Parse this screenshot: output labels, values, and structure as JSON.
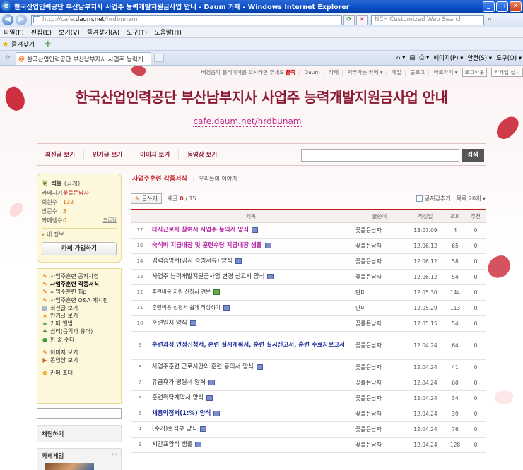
{
  "browser": {
    "window_title": "한국산업인력공단 부산남부지사 사업주 능력개발지원금사업 안내 - Daum 카페 - Windows Internet Explorer",
    "url_prefix": "http://cafe.",
    "url_domain": "daum.net",
    "url_path": "/hrdbunam",
    "search_placeholder": "NCH Customized Web Search",
    "menu": [
      "파일(F)",
      "편집(E)",
      "보기(V)",
      "즐겨찾기(A)",
      "도구(T)",
      "도움말(H)"
    ],
    "favorites_label": "즐겨찾기",
    "tab_title": "한국산업인력공단 부산남부지사 사업주 능력개...",
    "cmd": [
      "페이지(P) ▾",
      "안전(S) ▾",
      "도구(O) ▾"
    ]
  },
  "cafe": {
    "topmenu": {
      "bgm": "배경음악 플레이어를 끄시려면 주세요",
      "bgm_bold": "끌쭉",
      "links": [
        "Daum",
        "카페",
        "자주가는 카페 ▾",
        "메일",
        "블로그",
        "바로가기 ▾"
      ],
      "logout": "로그아웃",
      "install": "카페앱 설치"
    },
    "title": "한국산업인력공단 부산남부지사 사업주 능력개발지원금사업 안내",
    "url": "cafe.daum.net/hrdbunam",
    "nav": [
      "최신글 보기",
      "인기글 보기",
      "이미지 보기",
      "동영상 보기"
    ],
    "search_btn": "검색"
  },
  "sidebar": {
    "level": "석불",
    "visibility": "(공개)",
    "rows": [
      {
        "k": "카페지기",
        "v": "꽃를든남자"
      },
      {
        "k": "회원수",
        "v": "132"
      },
      {
        "k": "방문수",
        "v": "5"
      },
      {
        "k": "카페랭수",
        "v": "0",
        "extra": "프로필"
      }
    ],
    "myinfo": "내 정보",
    "join": "카페 가입하기",
    "menu1": [
      {
        "icon": "✎",
        "color": "#d26a00",
        "label": "사업주훈련 공지사항"
      },
      {
        "icon": "✎",
        "color": "#d26a00",
        "label": "사업주훈련 각종서식",
        "active": true
      },
      {
        "icon": "✎",
        "color": "#d26a00",
        "label": "사업주훈련 Tip"
      },
      {
        "icon": "✎",
        "color": "#d26a00",
        "label": "사업주훈련 Q&A 게시판"
      },
      {
        "icon": "▤",
        "color": "#5a7fc0",
        "label": "최신글 보기"
      },
      {
        "icon": "★",
        "color": "#e0a000",
        "label": "인기글 보기"
      },
      {
        "icon": "◈",
        "color": "#4a8a3a",
        "label": "카페 앨범"
      },
      {
        "icon": "♣",
        "color": "#4a8a3a",
        "label": "쉼터(음악과 유머)"
      },
      {
        "icon": "●",
        "color": "#3a9a3a",
        "label": "한 줄 수다"
      }
    ],
    "menu2": [
      {
        "icon": "✎",
        "color": "#d26a00",
        "label": "이미지 보기"
      },
      {
        "icon": "▶",
        "color": "#c63",
        "label": "동영상 보기"
      }
    ],
    "menu3": [
      {
        "icon": "✿",
        "color": "#e0a000",
        "label": "카페 초대"
      }
    ],
    "chat": "채팅하기",
    "game": "카페게임"
  },
  "board": {
    "title": "사업주훈련 각종서식",
    "subtitle": "우리들의 이야기",
    "write": "글쓰기",
    "count_label": "새글",
    "count_new": "0",
    "count_sep": " / ",
    "count_total": "15",
    "notice_hide": "공지감추기",
    "perpage": "목록 20개 ▾",
    "headers": [
      "",
      "제목",
      "글쓴이",
      "작성일",
      "조회",
      "추천"
    ],
    "rows": [
      {
        "no": "17",
        "title": "타사근로자 참여시 사업주 동의서 양식",
        "author": "꽃를든남자",
        "date": "13.07.09",
        "views": "4",
        "rec": "0",
        "style": "hl",
        "icon": "doc"
      },
      {
        "no": "16",
        "title": "숙식비 지급대장 및 훈련수당 지급대장 샘플",
        "author": "꽃를든남자",
        "date": "12.06.12",
        "views": "65",
        "rec": "0",
        "style": "hl",
        "icon": "doc"
      },
      {
        "no": "14",
        "title": "경력증명서(강사 증빙서류) 양식",
        "author": "꽃를든남자",
        "date": "12.06.12",
        "views": "58",
        "rec": "0",
        "style": "",
        "icon": "doc"
      },
      {
        "no": "13",
        "title": "사업주 능력개발지원금사업 변경 신고서 양식",
        "author": "꽃를든남자",
        "date": "12.06.12",
        "views": "54",
        "rec": "0",
        "style": "",
        "icon": "doc"
      },
      {
        "no": "12",
        "title": "훈련비용 지원 신청서 견본",
        "author": "단미",
        "date": "12.05.30",
        "views": "144",
        "rec": "0",
        "style": "sm",
        "icon": "img"
      },
      {
        "no": "11",
        "title": "훈련비용 신청서 쉽게 작성하기",
        "author": "단미",
        "date": "12.05.29",
        "views": "113",
        "rec": "0",
        "style": "sm",
        "icon": "doc"
      },
      {
        "no": "10",
        "title": "훈련일지 양식",
        "author": "꽃를든남자",
        "date": "12.05.15",
        "views": "54",
        "rec": "0",
        "style": "",
        "icon": "doc"
      },
      {
        "no": "9",
        "title": "훈련과정 인정신청서, 훈련 실시계획서, 훈련 실시신고서, 훈련 수료자보고서",
        "author": "꽃를든남자",
        "date": "12.04.24",
        "views": "64",
        "rec": "0",
        "style": "bl",
        "icon": "",
        "tall": true
      },
      {
        "no": "8",
        "title": "사업주훈련 근로시간외 훈련 동의서 양식",
        "author": "꽃를든남자",
        "date": "12.04.24",
        "views": "41",
        "rec": "0",
        "style": "",
        "icon": "doc"
      },
      {
        "no": "7",
        "title": "유급휴가 명령서 양식",
        "author": "꽃를든남자",
        "date": "12.04.24",
        "views": "60",
        "rec": "0",
        "style": "",
        "icon": "doc"
      },
      {
        "no": "6",
        "title": "훈련위탁계약서 양식",
        "author": "꽃를든남자",
        "date": "12.04.24",
        "views": "34",
        "rec": "0",
        "style": "",
        "icon": "doc"
      },
      {
        "no": "5",
        "title": "채용약정서(1:%) 양식",
        "author": "꽃를든남자",
        "date": "12.04.24",
        "views": "39",
        "rec": "0",
        "style": "bl",
        "icon": "doc"
      },
      {
        "no": "4",
        "title": "(수기)출석부 양식",
        "author": "꽃를든남자",
        "date": "12.04.24",
        "views": "76",
        "rec": "0",
        "style": "",
        "icon": "doc"
      },
      {
        "no": "3",
        "title": "시간표양식 샘플",
        "author": "꽃를든남자",
        "date": "12.04.24",
        "views": "128",
        "rec": "0",
        "style": "",
        "icon": "doc"
      }
    ]
  }
}
